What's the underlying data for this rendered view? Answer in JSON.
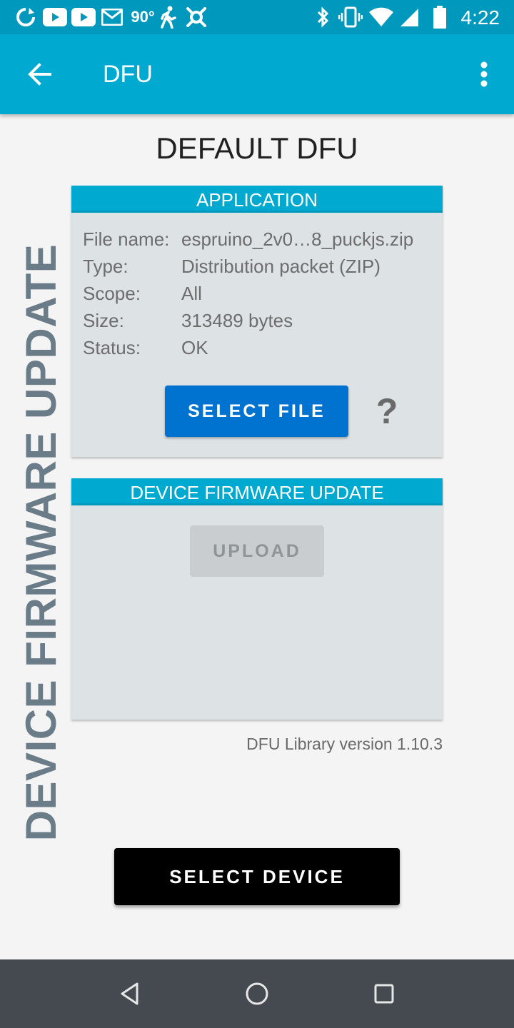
{
  "status_bar": {
    "time": "4:22",
    "temperature": "90°",
    "left_icons": [
      "sync-icon",
      "youtube-icon",
      "youtube-icon",
      "gmail-icon",
      "weather-temp",
      "walking-icon",
      "app-icon"
    ],
    "right_icons": [
      "bluetooth-icon",
      "vibrate-icon",
      "wifi-icon",
      "signal-icon",
      "battery-icon"
    ]
  },
  "app_bar": {
    "title": "DFU",
    "back_icon": "arrow-back-icon",
    "menu_icon": "more-vert-icon"
  },
  "side_label": "DEVICE FIRMWARE UPDATE",
  "heading": "DEFAULT DFU",
  "application_card": {
    "header": "APPLICATION",
    "rows": [
      {
        "key": "File name:",
        "value": "espruino_2v0…8_puckjs.zip"
      },
      {
        "key": "Type:",
        "value": "Distribution packet (ZIP)"
      },
      {
        "key": "Scope:",
        "value": "All"
      },
      {
        "key": "Size:",
        "value": "313489 bytes"
      },
      {
        "key": "Status:",
        "value": "OK"
      }
    ],
    "select_file_label": "SELECT FILE",
    "help_label": "?"
  },
  "dfu_card": {
    "header": "DEVICE FIRMWARE UPDATE",
    "upload_label": "UPLOAD",
    "upload_enabled": false
  },
  "library_version": "DFU Library version 1.10.3",
  "select_device_label": "SELECT DEVICE",
  "nav_bar": {
    "icons": [
      "back-triangle-icon",
      "home-circle-icon",
      "recents-square-icon"
    ]
  },
  "colors": {
    "status_bar": "#0099bd",
    "app_bar": "#00a9cf",
    "primary_button": "#0072cf",
    "card_background": "#dde2e4",
    "side_label": "#6b7c89",
    "nav_bar": "#444a4f"
  }
}
